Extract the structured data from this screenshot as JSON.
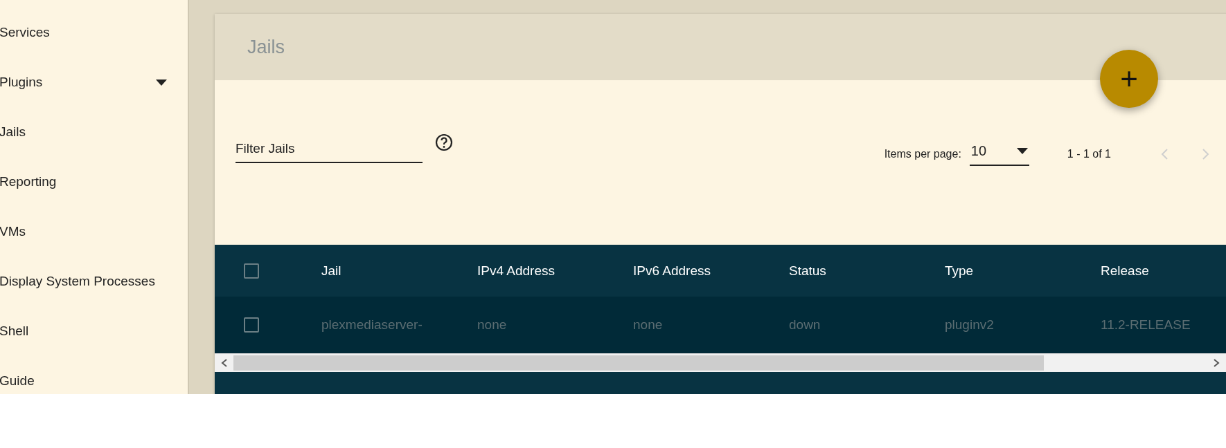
{
  "sidebar": {
    "items": [
      {
        "label": "Services",
        "expandable": false
      },
      {
        "label": "Plugins",
        "expandable": true
      },
      {
        "label": "Jails",
        "expandable": false
      },
      {
        "label": "Reporting",
        "expandable": false
      },
      {
        "label": "VMs",
        "expandable": false
      },
      {
        "label": "Display System Processes",
        "expandable": false
      },
      {
        "label": "Shell",
        "expandable": false
      },
      {
        "label": "Guide",
        "expandable": false
      }
    ]
  },
  "card": {
    "title": "Jails",
    "add_button": "+",
    "filter": {
      "placeholder": "Filter Jails"
    },
    "paginator": {
      "items_per_page_label": "Items per page:",
      "page_size": "10",
      "range": "1 - 1 of 1",
      "prev_disabled": true,
      "next_disabled": true
    },
    "table": {
      "columns": [
        "Jail",
        "IPv4 Address",
        "IPv6 Address",
        "Status",
        "Type",
        "Release"
      ],
      "all_checked": false,
      "rows": [
        {
          "checked": false,
          "cells": [
            "plexmediaserver-",
            "none",
            "none",
            "down",
            "pluginv2",
            "11.2-RELEASE"
          ]
        }
      ]
    }
  }
}
